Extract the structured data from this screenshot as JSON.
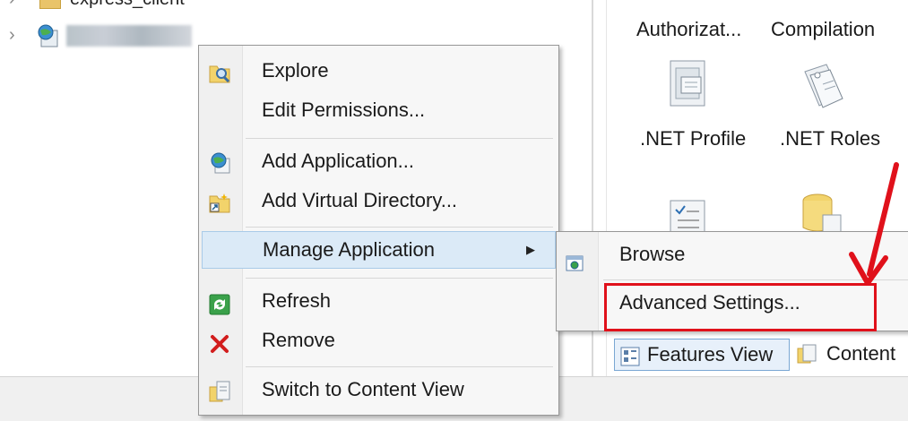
{
  "tree": {
    "top_node_label": "express_client",
    "site_node_label": ""
  },
  "features": {
    "row1": [
      "Authorizat...",
      "Compilation"
    ],
    "row2": [
      ".NET Profile",
      ".NET Roles"
    ]
  },
  "context_menu": {
    "items": [
      {
        "label": "Explore",
        "icon": "folder-search-icon"
      },
      {
        "label": "Edit Permissions...",
        "icon": ""
      },
      {
        "label": "Add Application...",
        "icon": "globe-app-icon"
      },
      {
        "label": "Add Virtual Directory...",
        "icon": "virtual-directory-icon"
      },
      {
        "label": "Manage Application",
        "icon": "",
        "submenu_arrow": "▶"
      },
      {
        "label": "Refresh",
        "icon": "refresh-icon"
      },
      {
        "label": "Remove",
        "icon": "remove-icon"
      },
      {
        "label": "Switch to Content View",
        "icon": "content-view-icon"
      }
    ]
  },
  "submenu": {
    "items": [
      {
        "label": "Browse",
        "icon": "browse-icon"
      },
      {
        "label": "Advanced Settings...",
        "icon": ""
      }
    ]
  },
  "view_tabs": {
    "features_view": "Features View",
    "content_view": "Content"
  },
  "colors": {
    "highlight": "#dbeaf7",
    "annotation_red": "#e0111b"
  }
}
